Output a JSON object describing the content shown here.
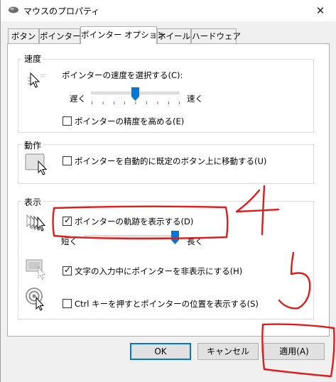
{
  "window": {
    "title": "マウスのプロパティ",
    "close_glyph": "✕"
  },
  "tabs": [
    {
      "label": "ボタン"
    },
    {
      "label": "ポインター"
    },
    {
      "label": "ポインター オプション",
      "active": true
    },
    {
      "label": "ホイール"
    },
    {
      "label": "ハードウェア"
    }
  ],
  "speed": {
    "group_label": "速度",
    "prompt": "ポインターの速度を選択する(C):",
    "slow_label": "遅く",
    "fast_label": "速く",
    "slider_value": 0.5,
    "precision_label": "ポインターの精度を高める(E)",
    "precision_checked": false
  },
  "snap": {
    "group_label": "動作",
    "label": "ポインターを自動的に既定のボタン上に移動する(U)",
    "checked": false
  },
  "visibility": {
    "group_label": "表示",
    "trails_label": "ポインターの軌跡を表示する(D)",
    "trails_checked": true,
    "short_label": "短く",
    "long_label": "長く",
    "trails_value": 1.0,
    "hide_label": "文字の入力中にポインターを非表示にする(H)",
    "hide_checked": true,
    "ctrl_label": "Ctrl キーを押すとポインターの位置を表示する(S)",
    "ctrl_checked": false,
    "check_glyph": "✓"
  },
  "buttons": {
    "ok": "OK",
    "cancel": "キャンセル",
    "apply": "適用(A)"
  },
  "annotations": {
    "color": "#e01c1c",
    "labels": [
      "4",
      "5"
    ]
  }
}
